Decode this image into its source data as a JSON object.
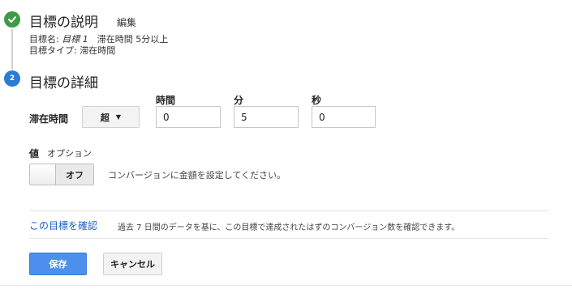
{
  "step1": {
    "title": "目標の説明",
    "edit_label": "編集",
    "summary": {
      "name_prefix": "目標名: ",
      "name_value": "目標 1",
      "name_suffix": "　滞在時間 5分以上",
      "type_line": "目標タイプ: 滞在時間"
    }
  },
  "step2": {
    "number": "2",
    "title": "目標の詳細",
    "duration_label": "滞在時間",
    "comparison_value": "超",
    "fields": {
      "hours_label": "時間",
      "hours_value": "0",
      "minutes_label": "分",
      "minutes_value": "5",
      "seconds_label": "秒",
      "seconds_value": "0"
    },
    "value": {
      "label": "値",
      "optional_label": "オプション",
      "toggle_state": "オフ",
      "description": "コンバージョンに金額を設定してください。"
    }
  },
  "verify": {
    "link_label": "この目標を確認",
    "description": "過去 7 日間のデータを基に、この目標で達成されたはずのコンバージョン数を確認できます。"
  },
  "actions": {
    "save_label": "保存",
    "cancel_label": "キャンセル"
  },
  "colors": {
    "step_complete": "#3e9a47",
    "step_active": "#2b7cd3",
    "link": "#1a62c2",
    "primary_button": "#4d8fec"
  }
}
